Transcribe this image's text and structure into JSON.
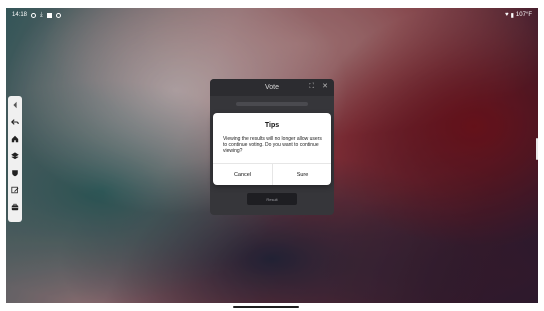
{
  "status_bar": {
    "time": "14:18",
    "battery_text": "107°F",
    "icons": [
      "gear-icon",
      "download-icon",
      "square-icon",
      "ring-icon",
      "heart-icon",
      "battery-icon"
    ]
  },
  "side_toolbar": {
    "items": [
      {
        "name": "collapse-arrow-icon"
      },
      {
        "name": "back-icon"
      },
      {
        "name": "home-icon"
      },
      {
        "name": "layers-icon"
      },
      {
        "name": "shield-icon"
      },
      {
        "name": "edit-icon"
      },
      {
        "name": "toolbox-icon"
      }
    ]
  },
  "vote_window": {
    "title": "Vote",
    "expand_icon": "⛶",
    "close_icon": "✕",
    "result_button": "Result"
  },
  "dialog": {
    "title": "Tips",
    "message": "Viewing the results will no longer allow users to continue voting. Do you want to continue viewing?",
    "cancel_label": "Cancel",
    "confirm_label": "Sure"
  }
}
